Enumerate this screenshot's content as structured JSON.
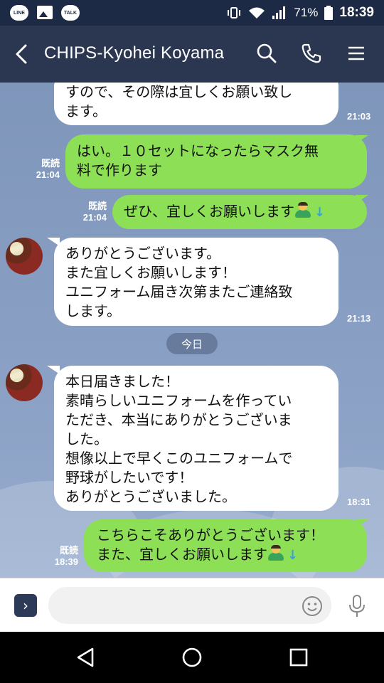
{
  "status_bar": {
    "apps": [
      "LINE",
      "TALK"
    ],
    "battery": "71%",
    "time": "18:39"
  },
  "header": {
    "title": "CHIPS-Kyohei Koyama",
    "icons": [
      "back-icon",
      "search-icon",
      "phone-icon",
      "menu-icon"
    ]
  },
  "messages": [
    {
      "dir": "in",
      "text": "すので、その際は宜しくお願い致し\nます。",
      "time": "21:03"
    },
    {
      "dir": "out",
      "text": "はい。１０セットになったらマスク無\n料で作ります",
      "read": "既読",
      "time": "21:04"
    },
    {
      "dir": "out",
      "text": "ぜひ、宜しくお願いします",
      "read": "既読",
      "time": "21:04",
      "emoji": [
        "person-emoji",
        "arrow-down-emoji"
      ]
    },
    {
      "dir": "in",
      "text": "ありがとうございます。\nまた宜しくお願いします！\nユニフォーム届き次第またご連絡致\nします。",
      "time": "21:13"
    },
    {
      "dir": "in",
      "text": "本日届きました！\n素晴らしいユニフォームを作ってい\nただき、本当にありがとうございま\nした。\n想像以上で早くこのユニフォームで\n野球がしたいです！\nありがとうございました。",
      "time": "18:31"
    },
    {
      "dir": "out",
      "text": "こちらこそありがとうございます！\nまた、宜しくお願いします",
      "read": "既読",
      "time": "18:39",
      "emoji": [
        "person-emoji",
        "arrow-down-emoji"
      ]
    }
  ],
  "date_separator": "今日",
  "input": {
    "placeholder": "",
    "value": ""
  },
  "colors": {
    "header": "#2b3751",
    "outgoing_bubble": "#8de055",
    "incoming_bubble": "#ffffff",
    "chat_background": "#7f96bb"
  }
}
